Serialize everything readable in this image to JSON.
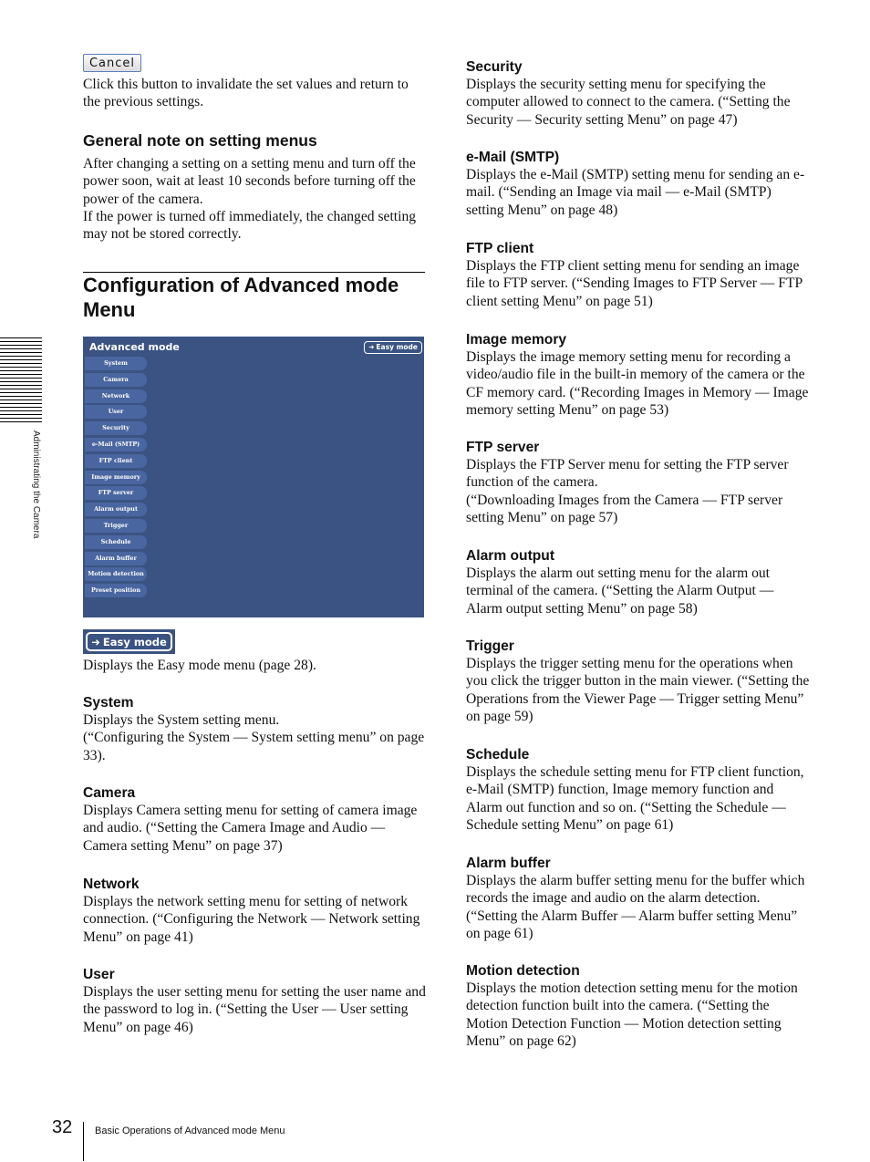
{
  "cancel": {
    "button_label": "Cancel",
    "description": "Click this button to invalidate the set values and return to the previous settings."
  },
  "general_note": {
    "heading": "General note on setting menus",
    "paragraph1": "After changing a setting on a setting menu and turn off the power soon, wait at least 10 seconds before turning off the power of the camera.",
    "paragraph2": "If the power is turned off immediately, the changed setting may not be stored correctly."
  },
  "section": {
    "title": "Configuration of Advanced mode Menu"
  },
  "panel": {
    "title": "Advanced mode",
    "easy_mode_label": "Easy mode",
    "bg_color": "#3b5383",
    "menu_items": [
      "System",
      "Camera",
      "Network",
      "User",
      "Security",
      "e-Mail (SMTP)",
      "FTP client",
      "Image memory",
      "FTP server",
      "Alarm output",
      "Trigger",
      "Schedule",
      "Alarm buffer",
      "Motion detection",
      "Preset position"
    ]
  },
  "easy_mode": {
    "button_label": "Easy mode",
    "description": "Displays the Easy mode menu (page 28)."
  },
  "entries_left": [
    {
      "heading": "System",
      "text": "Displays the System setting menu.\n(“Configuring the System — System setting menu” on page 33)."
    },
    {
      "heading": "Camera",
      "text": "Displays Camera setting menu for setting of camera image and audio. (“Setting the Camera Image and Audio — Camera setting Menu” on page 37)"
    },
    {
      "heading": "Network",
      "text": "Displays the network setting menu for setting of network connection. (“Configuring the Network — Network setting Menu” on page 41)"
    },
    {
      "heading": "User",
      "text": "Displays the user setting menu for setting the user name and the password to log in. (“Setting the User — User setting Menu” on page 46)"
    }
  ],
  "entries_right": [
    {
      "heading": "Security",
      "text": "Displays the security setting menu for specifying the computer allowed to connect to the camera. (“Setting the Security — Security setting Menu” on page 47)"
    },
    {
      "heading": "e-Mail (SMTP)",
      "text": "Displays the e-Mail (SMTP) setting menu for sending an e-mail. (“Sending an Image via mail — e-Mail (SMTP) setting Menu” on page 48)"
    },
    {
      "heading": "FTP client",
      "text": "Displays the FTP client setting menu for sending an image file to FTP server. (“Sending Images to FTP Server — FTP client setting Menu” on page 51)"
    },
    {
      "heading": "Image memory",
      "text": "Displays the image memory setting menu for recording a video/audio file in the built-in memory of the camera or the CF memory card. (“Recording Images in Memory — Image memory setting Menu” on page 53)"
    },
    {
      "heading": "FTP server",
      "text": "Displays the FTP Server menu for setting the FTP server function of the camera.\n(“Downloading Images from the Camera — FTP server setting Menu” on page 57)"
    },
    {
      "heading": "Alarm output",
      "text": "Displays the alarm out setting menu for the alarm out terminal of the camera. (“Setting the Alarm Output — Alarm output setting Menu” on page 58)"
    },
    {
      "heading": "Trigger",
      "text": "Displays the trigger setting menu for the operations when you click the trigger button in the main viewer. (“Setting the Operations from the Viewer Page — Trigger setting Menu” on page 59)"
    },
    {
      "heading": "Schedule",
      "text": "Displays the schedule setting menu for FTP client function, e-Mail (SMTP) function, Image memory function and Alarm out function and so on. (“Setting the Schedule — Schedule setting Menu” on page 61)"
    },
    {
      "heading": "Alarm buffer",
      "text": "Displays the alarm buffer setting menu for the buffer which records the image and audio on the alarm detection. (“Setting the Alarm Buffer — Alarm buffer setting Menu” on page 61)"
    },
    {
      "heading": "Motion detection",
      "text": "Displays the motion detection setting menu for the motion detection function built into the camera. (“Setting the Motion Detection Function — Motion detection setting Menu” on page 62)"
    }
  ],
  "side_tab": {
    "label": "Administrating the Camera"
  },
  "footer": {
    "page_number": "32",
    "title": "Basic Operations of Advanced mode Menu"
  }
}
